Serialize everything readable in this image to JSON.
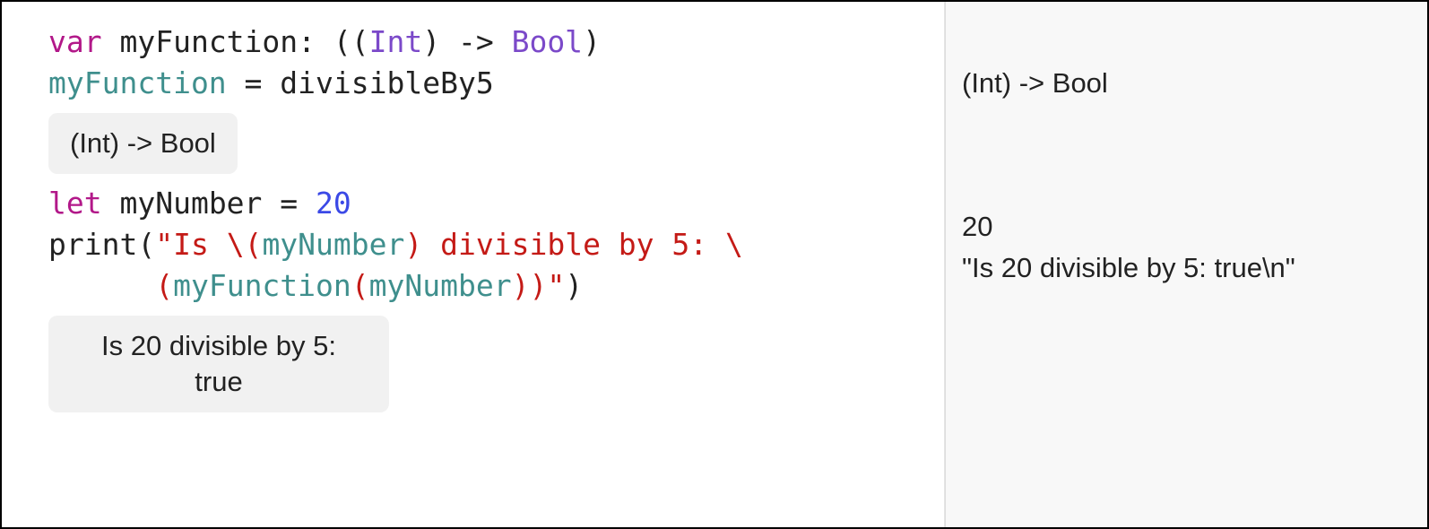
{
  "code": {
    "line1": {
      "kw": "var",
      "name": " myFunction: ((",
      "type1": "Int",
      "mid": ") -> ",
      "type2": "Bool",
      "end": ")"
    },
    "line2": {
      "lhs": "myFunction",
      "eq": " = ",
      "rhs": "divisibleBy5"
    },
    "inline1": "(Int) -> Bool",
    "line3": {
      "kw": "let",
      "name": " myNumber = ",
      "num": "20"
    },
    "line4": {
      "call": "print",
      "lp": "(",
      "s1": "\"Is \\(",
      "i1": "myNumber",
      "s2": ") divisible by 5: \\",
      "indent": "      ",
      "lp2": "(",
      "i2a": "myFunction",
      "lp3": "(",
      "i2b": "myNumber",
      "rp3": ")",
      "rp2": ")",
      "s3": "\"",
      "rp": ")"
    },
    "inline2": "Is 20 divisible by 5:\ntrue"
  },
  "results": {
    "r1": "(Int) -> Bool",
    "r2": "20",
    "r3": "\"Is 20 divisible by 5: true\\n\""
  }
}
